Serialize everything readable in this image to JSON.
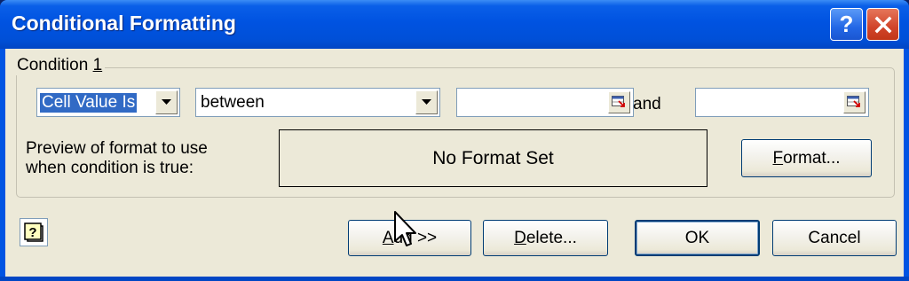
{
  "window": {
    "title": "Conditional Formatting"
  },
  "titlebar_buttons": {
    "help_icon": "question-mark-icon",
    "close_icon": "close-x-icon"
  },
  "condition": {
    "group_label_prefix": "Condition ",
    "group_label_number": "1",
    "type_value": "Cell Value Is",
    "operator_value": "between",
    "value1": "",
    "and_label": "and",
    "value2": "",
    "preview_label_line1": "Preview of format to use",
    "preview_label_line2": "when condition is true:",
    "preview_text": "No Format Set",
    "format_button": {
      "accel": "F",
      "rest": "ormat..."
    }
  },
  "buttons": {
    "add": {
      "accel": "A",
      "rest": "dd >>"
    },
    "delete": {
      "accel": "D",
      "rest": "elete..."
    },
    "ok": "OK",
    "cancel": "Cancel"
  },
  "colors": {
    "titlebar": "#0054e3",
    "dialog_bg": "#ece9d8",
    "selection": "#316ac5",
    "close_button": "#d1442a"
  }
}
